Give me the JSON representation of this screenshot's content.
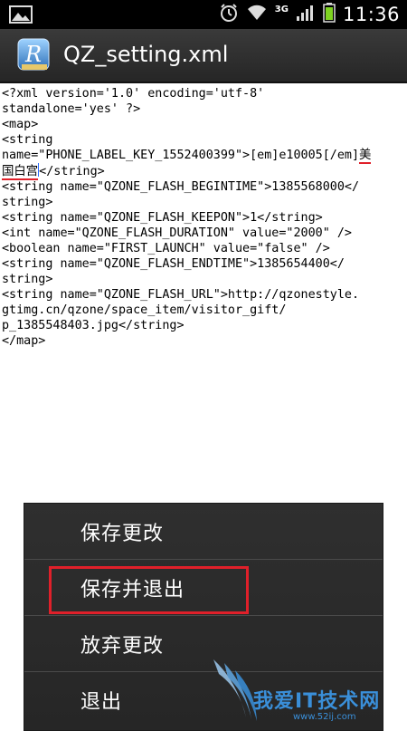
{
  "status_bar": {
    "time": "11:36",
    "network": "3G"
  },
  "title_bar": {
    "title": "QZ_setting.xml",
    "app_icon_letter": "R"
  },
  "xml": {
    "line1": "<?xml version='1.0' encoding='utf-8'",
    "line2": "standalone='yes' ?>",
    "line3": "<map>",
    "line4": "<string",
    "line5a": "name=\"PHONE_LABEL_KEY_1552400399\">[em]e10005[/em]",
    "line5b": "美",
    "line6a": "国白宫",
    "line6b": "</string>",
    "line7": "<string name=\"QZONE_FLASH_BEGINTIME\">1385568000</",
    "line8": "string>",
    "line9": "<string name=\"QZONE_FLASH_KEEPON\">1</string>",
    "line10": "<int name=\"QZONE_FLASH_DURATION\" value=\"2000\" />",
    "line11": "<boolean name=\"FIRST_LAUNCH\" value=\"false\" />",
    "line12": "<string name=\"QZONE_FLASH_ENDTIME\">1385654400</",
    "line13": "string>",
    "line14": "<string name=\"QZONE_FLASH_URL\">http://qzonestyle.",
    "line15": "gtimg.cn/qzone/space_item/visitor_gift/",
    "line16": "p_1385548403.jpg</string>",
    "line17": "</map>"
  },
  "menu": {
    "items": [
      {
        "label": "保存更改"
      },
      {
        "label": "保存并退出"
      },
      {
        "label": "放弃更改"
      },
      {
        "label": "退出"
      }
    ]
  },
  "watermark": {
    "text": "我爱IT技术网",
    "url": "www.52ij.com"
  },
  "colors": {
    "highlight_red": "#e0202a",
    "cursor_blue": "#2b6cff",
    "watermark_blue": "#3a8fd9"
  }
}
